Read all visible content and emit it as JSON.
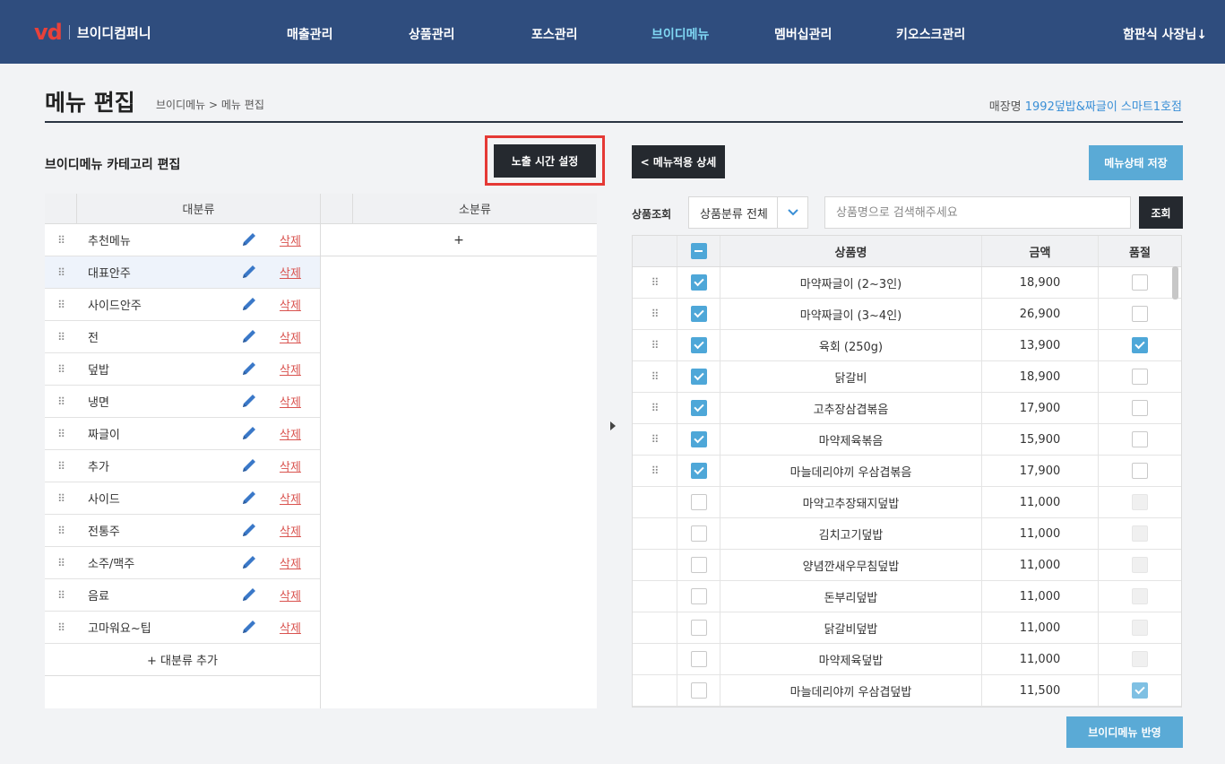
{
  "header": {
    "logo_mark": "vd",
    "company": "브이디컴퍼니",
    "nav": [
      "매출관리",
      "상품관리",
      "포스관리",
      "브이디메뉴",
      "멤버십관리",
      "키오스크관리"
    ],
    "active_nav": "브이디메뉴",
    "user": "함판식 사장님↓"
  },
  "page": {
    "title": "메뉴 편집",
    "breadcrumb": "브이디메뉴 > 메뉴 편집",
    "store_label": "매장명",
    "store_name": "1992덮밥&짜글이 스마트1호점"
  },
  "left": {
    "section_title": "브이디메뉴 카테고리 편집",
    "exposure_button": "노출 시간 설정",
    "major_header": "대분류",
    "minor_header": "소분류",
    "minor_add": "+",
    "delete_label": "삭제",
    "add_major": "+ 대분류 추가",
    "categories": [
      "추천메뉴",
      "대표안주",
      "사이드안주",
      "전",
      "덮밥",
      "냉면",
      "짜글이",
      "추가",
      "사이드",
      "전통주",
      "소주/맥주",
      "음료",
      "고마워요~팁"
    ],
    "selected_index": 1
  },
  "right": {
    "detail_button": "< 메뉴적용 상세",
    "save_button": "메뉴상태 저장",
    "search_label": "상품조회",
    "category_select": "상품분류 전체",
    "search_placeholder": "상품명으로 검색해주세요",
    "search_button": "조회",
    "columns": [
      "상품명",
      "금액",
      "품절"
    ],
    "apply_button": "브이디메뉴 반영",
    "products": [
      {
        "name": "마약짜글이 (2~3인)",
        "price": "18,900",
        "checked": true,
        "soldout": false,
        "draggable": true
      },
      {
        "name": "마약짜글이 (3~4인)",
        "price": "26,900",
        "checked": true,
        "soldout": false,
        "draggable": true
      },
      {
        "name": "육회 (250g)",
        "price": "13,900",
        "checked": true,
        "soldout": true,
        "draggable": true
      },
      {
        "name": "닭갈비",
        "price": "18,900",
        "checked": true,
        "soldout": false,
        "draggable": true
      },
      {
        "name": "고추장삼겹볶음",
        "price": "17,900",
        "checked": true,
        "soldout": false,
        "draggable": true
      },
      {
        "name": "마약제육볶음",
        "price": "15,900",
        "checked": true,
        "soldout": false,
        "draggable": true
      },
      {
        "name": "마늘데리야끼 우삼겹볶음",
        "price": "17,900",
        "checked": true,
        "soldout": false,
        "draggable": true
      },
      {
        "name": "마약고추장돼지덮밥",
        "price": "11,000",
        "checked": false,
        "soldout": false,
        "draggable": false
      },
      {
        "name": "김치고기덮밥",
        "price": "11,000",
        "checked": false,
        "soldout": false,
        "draggable": false
      },
      {
        "name": "양념깐새우무침덮밥",
        "price": "11,000",
        "checked": false,
        "soldout": false,
        "draggable": false
      },
      {
        "name": "돈부리덮밥",
        "price": "11,000",
        "checked": false,
        "soldout": false,
        "draggable": false
      },
      {
        "name": "닭갈비덮밥",
        "price": "11,000",
        "checked": false,
        "soldout": false,
        "draggable": false
      },
      {
        "name": "마약제육덮밥",
        "price": "11,000",
        "checked": false,
        "soldout": false,
        "draggable": false
      },
      {
        "name": "마늘데리야끼 우삼겹덮밥",
        "price": "11,500",
        "checked": false,
        "soldout": true,
        "draggable": false
      }
    ]
  }
}
